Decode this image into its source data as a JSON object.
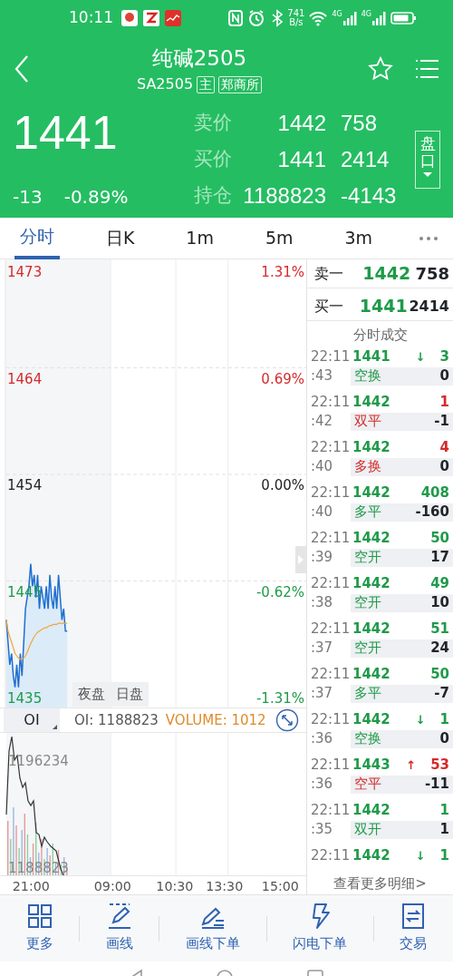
{
  "status_bar": {
    "time": "10:11",
    "speed": "741",
    "speed_unit": "B/s",
    "networks": [
      "4G",
      "4G"
    ]
  },
  "header": {
    "title": "纯碱2505",
    "code": "SA2505",
    "tags": [
      "主",
      "郑商所"
    ]
  },
  "quote": {
    "price": "1441",
    "change": "-13",
    "change_percent": "-0.89%",
    "side_button": "盘口",
    "rows": [
      {
        "label": "卖价",
        "price": "1442",
        "volume": "758"
      },
      {
        "label": "买价",
        "price": "1441",
        "volume": "2414"
      },
      {
        "label": "持仓",
        "price": "1188823",
        "volume": "-4143"
      }
    ]
  },
  "tabs": [
    {
      "label": "分时",
      "selected": true
    },
    {
      "label": "日K",
      "selected": false
    },
    {
      "label": "1m",
      "selected": false
    },
    {
      "label": "5m",
      "selected": false
    },
    {
      "label": "3m",
      "selected": false
    }
  ],
  "chart": {
    "price_labels": [
      {
        "text": "1473",
        "color": "#d42a2a"
      },
      {
        "text": "1464",
        "color": "#d42a2a"
      },
      {
        "text": "1454",
        "color": "#222222"
      },
      {
        "text": "1445",
        "color": "#1f9a49"
      },
      {
        "text": "1435",
        "color": "#1f9a49"
      }
    ],
    "percent_labels": [
      {
        "text": "1.31%",
        "color": "#d42a2a"
      },
      {
        "text": "0.69%",
        "color": "#d42a2a"
      },
      {
        "text": "0.00%",
        "color": "#222222"
      },
      {
        "text": "-0.62%",
        "color": "#1f9a49"
      },
      {
        "text": "-1.31%",
        "color": "#1f9a49"
      }
    ],
    "sessions": [
      "夜盘",
      "日盘"
    ],
    "time_axis": [
      "21:00",
      "09:00",
      "10:30",
      "13:30",
      "15:00"
    ]
  },
  "indicator_bar": {
    "selector": "OI",
    "oi": "OI: 1188823",
    "volume": "VOLUME: 1012"
  },
  "oi_chart": {
    "high_label": "1196234",
    "low_label": "1188823"
  },
  "order_book": [
    {
      "label": "卖一",
      "price": "1442",
      "volume": "758"
    },
    {
      "label": "买一",
      "price": "1441",
      "volume": "2414"
    }
  ],
  "trades": {
    "title": "分时成交",
    "more_link": "查看更多明细>",
    "rows": [
      {
        "time": "22:11",
        "price": "1441",
        "arrow": "↓",
        "volume": "3",
        "color": "#1f9a49",
        "second": ":43",
        "type": "空换",
        "oi_change": "0"
      },
      {
        "time": "22:11",
        "price": "1442",
        "volume": "1",
        "color": "#d42a2a",
        "second": ":42",
        "type": "双平",
        "oi_change": "-1"
      },
      {
        "time": "22:11",
        "price": "1442",
        "volume": "4",
        "color": "#d42a2a",
        "second": ":40",
        "type": "多换",
        "oi_change": "0"
      },
      {
        "time": "22:11",
        "price": "1442",
        "volume": "408",
        "color": "#1f9a49",
        "second": ":40",
        "type": "多平",
        "oi_change": "-160"
      },
      {
        "time": "22:11",
        "price": "1442",
        "volume": "50",
        "color": "#1f9a49",
        "second": ":39",
        "type": "空开",
        "oi_change": "17"
      },
      {
        "time": "22:11",
        "price": "1442",
        "volume": "49",
        "color": "#1f9a49",
        "second": ":38",
        "type": "空开",
        "oi_change": "10"
      },
      {
        "time": "22:11",
        "price": "1442",
        "volume": "51",
        "color": "#1f9a49",
        "second": ":37",
        "type": "空开",
        "oi_change": "24"
      },
      {
        "time": "22:11",
        "price": "1442",
        "volume": "50",
        "color": "#1f9a49",
        "second": ":37",
        "type": "多平",
        "oi_change": "-7"
      },
      {
        "time": "22:11",
        "price": "1442",
        "arrow": "↓",
        "volume": "1",
        "color": "#1f9a49",
        "second": ":36",
        "type": "空换",
        "oi_change": "0"
      },
      {
        "time": "22:11",
        "price": "1443",
        "arrow": "↑",
        "volume": "53",
        "color": "#d42a2a",
        "second": ":36",
        "type": "空平",
        "oi_change": "-11"
      },
      {
        "time": "22:11",
        "price": "1442",
        "volume": "1",
        "color": "#1f9a49",
        "second": ":35",
        "type": "双开",
        "oi_change": "1"
      },
      {
        "time": "22:11",
        "price": "1442",
        "arrow": "↓",
        "volume": "1",
        "color": "#1f9a49"
      }
    ]
  },
  "toolbar": [
    {
      "kind": "grid",
      "label": "更多"
    },
    {
      "kind": "pen",
      "label": "画线"
    },
    {
      "kind": "pen-lines",
      "label": "画线下单"
    },
    {
      "kind": "lightning",
      "label": "闪电下单"
    },
    {
      "kind": "swap",
      "label": "交易"
    }
  ]
}
